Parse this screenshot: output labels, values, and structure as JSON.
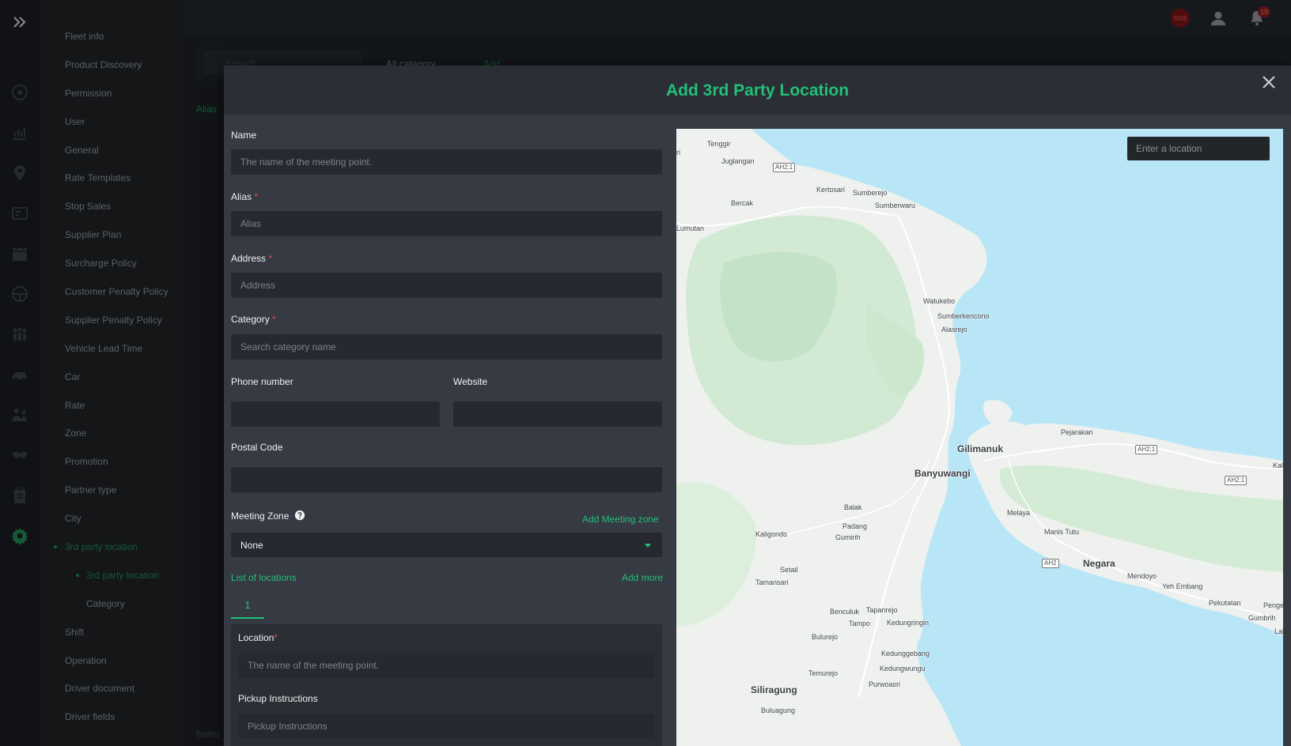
{
  "sidebar": {
    "items": [
      {
        "label": "Fleet info"
      },
      {
        "label": "Product Discovery"
      },
      {
        "label": "Permission"
      },
      {
        "label": "User"
      },
      {
        "label": "General"
      },
      {
        "label": "Rate Templates"
      },
      {
        "label": "Stop Sales"
      },
      {
        "label": "Supplier Plan"
      },
      {
        "label": "Surcharge Policy"
      },
      {
        "label": "Customer Penalty Policy"
      },
      {
        "label": "Supplier Penalty Policy"
      },
      {
        "label": "Vehicle Lead Time"
      },
      {
        "label": "Car"
      },
      {
        "label": "Rate"
      },
      {
        "label": "Zone"
      },
      {
        "label": "Promotion"
      },
      {
        "label": "Partner type"
      },
      {
        "label": "City"
      },
      {
        "label": "3rd party location"
      },
      {
        "label": "3rd party location"
      },
      {
        "label": "Category"
      },
      {
        "label": "Shift"
      },
      {
        "label": "Operation"
      },
      {
        "label": "Driver document"
      },
      {
        "label": "Driver fields"
      }
    ]
  },
  "topbar": {
    "sos_label": "SOS",
    "notification_count": "19"
  },
  "background": {
    "search_placeholder": "Search",
    "category_filter": "All category",
    "add_label": "Add",
    "alias_header": "Alias",
    "items_label": "Items"
  },
  "modal": {
    "title": "Add 3rd Party Location",
    "name": {
      "label": "Name",
      "placeholder": "The name of the meeting point."
    },
    "alias": {
      "label": "Alias",
      "placeholder": "Alias"
    },
    "address": {
      "label": "Address",
      "placeholder": "Address"
    },
    "category": {
      "label": "Category",
      "placeholder": "Search category name"
    },
    "phone": {
      "label": "Phone number",
      "value": ""
    },
    "website": {
      "label": "Website",
      "value": ""
    },
    "postal": {
      "label": "Postal Code",
      "value": ""
    },
    "meeting_zone": {
      "label": "Meeting Zone",
      "add_link": "Add Meeting zone",
      "selected": "None"
    },
    "locations": {
      "list_label": "List of locations",
      "add_more": "Add more",
      "tabs": [
        "1"
      ],
      "location": {
        "label": "Location",
        "placeholder": "The name of the meeting point."
      },
      "pickup": {
        "label": "Pickup Instructions",
        "placeholder": "Pickup Instructions"
      }
    },
    "required_mark": "*"
  },
  "map": {
    "search_placeholder": "Enter a location",
    "places": [
      "Tenggir",
      "Juglangan",
      "Kertosari",
      "Sumberejo",
      "Sumberwaru",
      "Bercak",
      "Lumutan",
      "Watukebo",
      "Sumberkencono",
      "Alasrejo",
      "Pejarakan",
      "Gilimanuk",
      "Banyuwangi",
      "Balak",
      "Padang",
      "Gumirih",
      "Kaligondo",
      "Melaya",
      "Manis Tutu",
      "Negara",
      "Mendoyo",
      "Yeh Embang",
      "Pekutatan",
      "Penge",
      "Gumbrih",
      "Setail",
      "Tamansari",
      "Benculuk",
      "Tapanrejo",
      "Tampo",
      "Kedungringin",
      "Bulurejo",
      "Kedunggebang",
      "Kedungwungu",
      "Temurejo",
      "Purwoasri",
      "Siliragung",
      "Buluagung",
      "Kal",
      "Lal",
      "ri"
    ],
    "road_labels": [
      "AH2;1",
      "AH2;1",
      "AH2;1",
      "AH2"
    ]
  }
}
